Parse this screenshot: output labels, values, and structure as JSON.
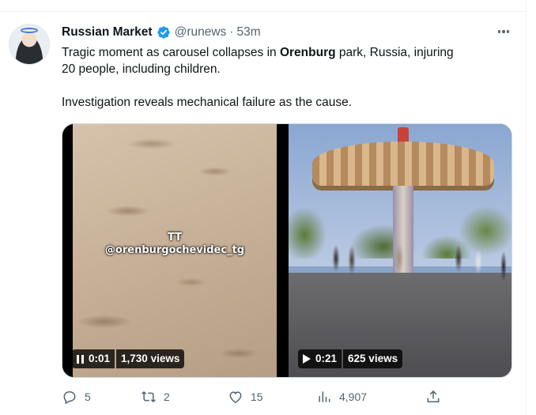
{
  "author": {
    "name": "Russian Market",
    "handle": "@runews",
    "separator": "·",
    "time": "53m",
    "verified": true,
    "verified_color": "#1d9bf0"
  },
  "tweet": {
    "line1_pre": "Tragic moment as carousel collapses in ",
    "line1_bold": "Orenburg",
    "line1_post": " park, Russia, injuring",
    "line2": "20 people, including children.",
    "line3": "Investigation reveals mechanical failure as the cause."
  },
  "media": {
    "video_left": {
      "watermark_top": "TT",
      "watermark_handle": "@orenburgochevidec_tg",
      "state_icon": "pause-icon",
      "time": "0:01",
      "views": "1,730 views"
    },
    "video_right": {
      "state_icon": "play-icon",
      "time": "0:21",
      "views": "625 views"
    }
  },
  "actions": {
    "replies": "5",
    "reposts": "2",
    "likes": "15",
    "views": "4,907"
  },
  "colors": {
    "text": "#0f1419",
    "secondary": "#536471",
    "border": "#cfd9de",
    "accent": "#1d9bf0"
  }
}
